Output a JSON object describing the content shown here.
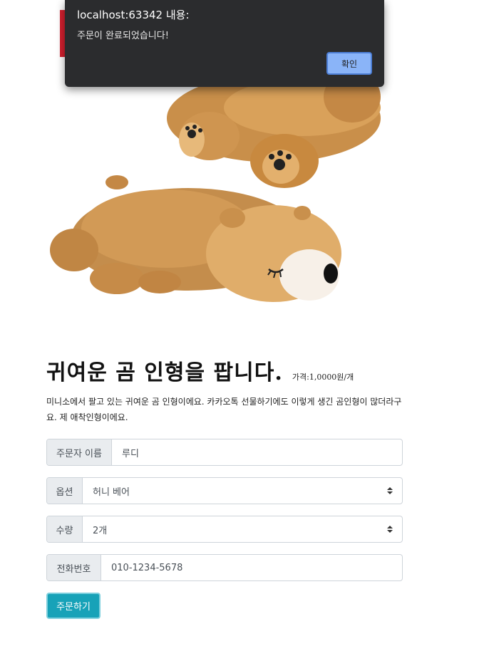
{
  "alert": {
    "title": "localhost:63342 내용:",
    "message": "주문이 완료되었습니다!",
    "ok_label": "확인"
  },
  "product": {
    "title": "귀여운 곰 인형을 팝니다.",
    "price": "가격:1,0000원/개",
    "description": "미니소에서 팔고 있는 귀여운 곰 인형이에요. 카카오톡 선물하기에도 이렇게 생긴 곰인형이 많더라구요. 제 애착인형이에요."
  },
  "form": {
    "name_label": "주문자 이름",
    "name_value": "루디",
    "option_label": "옵션",
    "option_value": "허니 베어",
    "quantity_label": "수량",
    "quantity_value": "2개",
    "phone_label": "전화번호",
    "phone_value": "010-1234-5678",
    "submit_label": "주문하기"
  },
  "colors": {
    "accent": "#17a2b8",
    "dialog_bg": "#2b2c2e",
    "dialog_button": "#8ab4f8",
    "red_strip": "#d4202f"
  }
}
